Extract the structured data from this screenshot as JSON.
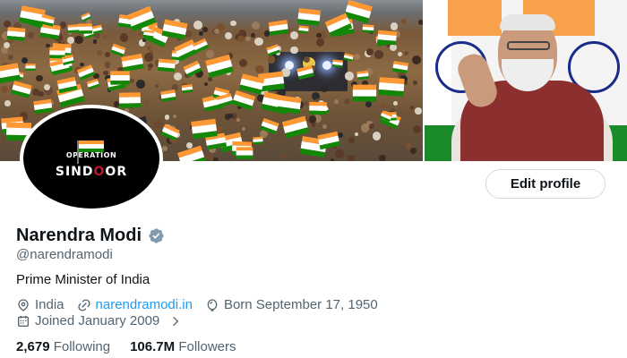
{
  "banner": {
    "avatar_text_top": "OPERATION",
    "avatar_text_main_a": "SIND",
    "avatar_text_main_o1": "O",
    "avatar_text_main_o2": "O",
    "avatar_text_main_b": "R"
  },
  "actions": {
    "edit_profile_label": "Edit profile"
  },
  "profile": {
    "name": "Narendra Modi",
    "handle": "@narendramodi",
    "bio": "Prime Minister of India",
    "location": "India",
    "website": "narendramodi.in",
    "birthday": "Born September 17, 1950",
    "joined": "Joined January 2009"
  },
  "stats": {
    "following_count": "2,679",
    "following_label": "Following",
    "followers_count": "106.7M",
    "followers_label": "Followers"
  },
  "colors": {
    "link": "#1d9bf0",
    "verified": "#829aab",
    "muted_text": "#536471",
    "primary_text": "#0f1419"
  },
  "icons": [
    "verified-badge-icon",
    "location-icon",
    "link-icon",
    "balloon-icon",
    "calendar-icon",
    "chevron-right-icon"
  ]
}
